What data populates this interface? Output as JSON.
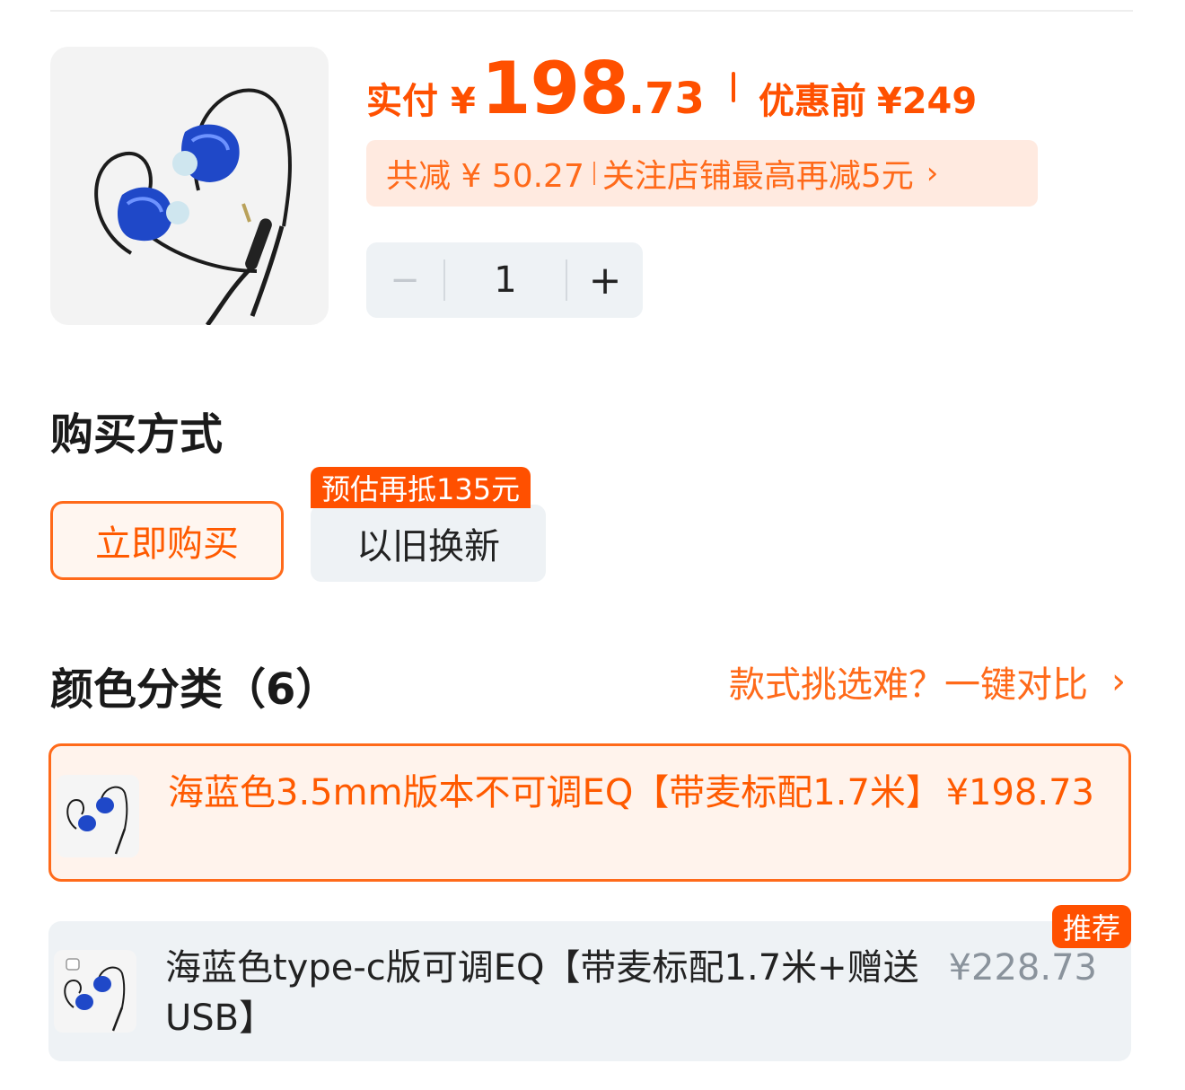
{
  "price": {
    "label": "实付",
    "yen": "¥",
    "integer": "198",
    "decimal": ".73",
    "original_label": "优惠前",
    "original_price": "¥249"
  },
  "promo": {
    "saving": "共减 ¥ 50.27",
    "follow": "关注店铺最高再减5元",
    "chevron": "›"
  },
  "quantity": {
    "minus": "−",
    "value": "1",
    "plus": "+"
  },
  "purchase": {
    "title": "购买方式",
    "buy_now": "立即购买",
    "trade_in": "以旧换新",
    "trade_in_badge": "预估再抵135元"
  },
  "variants": {
    "title": "颜色分类（6）",
    "compare_link": "款式挑选难？一键对比",
    "compare_chevron": "›",
    "items": [
      {
        "name": "海蓝色3.5mm版本不可调EQ【带麦标配1.7米】",
        "price": "¥198.73",
        "selected": true
      },
      {
        "name": "海蓝色type-c版可调EQ【带麦标配1.7米+赠送USB】",
        "price": "¥228.73",
        "badge": "推荐"
      }
    ]
  },
  "colors": {
    "accent": "#ff5000",
    "promo_bg": "#ffeae0",
    "gray_bg": "#eef2f5"
  }
}
